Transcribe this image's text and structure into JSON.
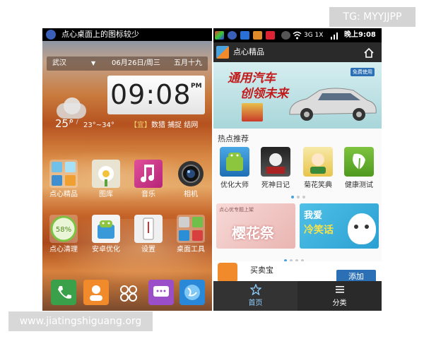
{
  "watermarks": {
    "top": "TG: MYYJJPP",
    "bottom": "www.jiatingshiguang.org"
  },
  "left_phone": {
    "notification": "点心桌面上的图标较少",
    "weather": {
      "city": "武汉",
      "date": "06月26日/周三",
      "lunar": "五月十九",
      "temperature": "25°",
      "range": "23°~34°",
      "almanac_tag": "【宜】",
      "almanac": "数猎 捕捉 结网"
    },
    "clock": {
      "time": "09:08",
      "meridiem": "PM"
    },
    "apps_row1": [
      {
        "label": "点心精品",
        "icon": "grid-folder-icon"
      },
      {
        "label": "图库",
        "icon": "flower-gallery-icon"
      },
      {
        "label": "音乐",
        "icon": "music-note-icon"
      },
      {
        "label": "相机",
        "icon": "camera-lens-icon"
      }
    ],
    "apps_row2": [
      {
        "label": "点心清理",
        "icon": "cleaner-percent-icon",
        "percent": "58%"
      },
      {
        "label": "安卓优化",
        "icon": "android-optimize-icon"
      },
      {
        "label": "设置",
        "icon": "settings-phone-icon"
      },
      {
        "label": "桌面工具",
        "icon": "desktop-tools-icon"
      }
    ],
    "dock": [
      {
        "icon": "phone-icon"
      },
      {
        "icon": "contacts-icon"
      },
      {
        "icon": "app-drawer-icon"
      },
      {
        "icon": "messages-icon"
      },
      {
        "icon": "browser-globe-icon"
      }
    ]
  },
  "right_phone": {
    "status_time": "晚上9:08",
    "status_network": "3G 1X",
    "title": "点心精品",
    "banner": {
      "line1": "通用汽车",
      "line2": "创领未来",
      "badge": "免费使用"
    },
    "section_title": "热点推荐",
    "hot_apps": [
      {
        "label": "优化大师",
        "icon": "android-master-icon"
      },
      {
        "label": "死神日记",
        "icon": "death-diary-icon"
      },
      {
        "label": "菊花笑典",
        "icon": "comic-laugh-icon"
      },
      {
        "label": "健康测试",
        "icon": "leaf-health-icon"
      }
    ],
    "promo1": {
      "small": "点心优专题上架",
      "big": "樱花祭"
    },
    "promo2": {
      "line1": "我爱",
      "line2": "冷笑话"
    },
    "list_item": {
      "name": "买卖宝",
      "button": "添加"
    },
    "tabs": [
      {
        "label": "首页",
        "icon": "star-icon"
      },
      {
        "label": "分类",
        "icon": "list-icon"
      }
    ]
  }
}
